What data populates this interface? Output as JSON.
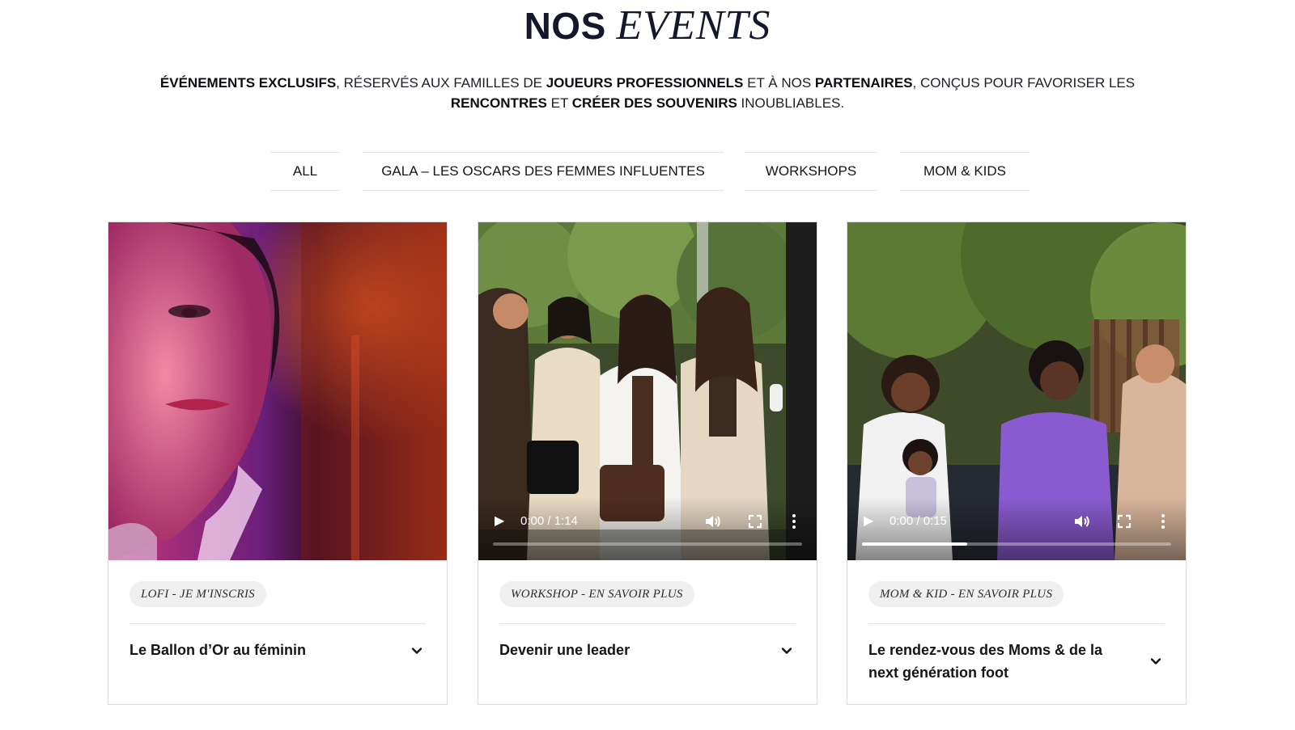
{
  "header": {
    "title_part1": "NOS",
    "title_part2": "EVENTS"
  },
  "intro": {
    "s1_bold": "ÉVÉNEMENTS EXCLUSIFS",
    "s2": ", RÉSERVÉS AUX FAMILLES DE ",
    "s3_bold": "JOUEURS PROFESSIONNELS",
    "s4": " ET À NOS ",
    "s5_bold": "PARTENAIRES",
    "s6": ", CONÇUS POUR FAVORISER LES ",
    "s7_bold": "RENCONTRES",
    "s8": " ET ",
    "s9_bold": "CRÉER DES SOUVENIRS",
    "s10": " INOUBLIABLES."
  },
  "tabs": [
    {
      "label": "ALL",
      "active": true
    },
    {
      "label": "GALA – LES OSCARS DES FEMMES INFLUENTES",
      "active": false
    },
    {
      "label": "WORKSHOPS",
      "active": false
    },
    {
      "label": "MOM & KIDS",
      "active": false
    }
  ],
  "cards": [
    {
      "tag": "LOFI - JE M'INSCRIS",
      "title": "Le Ballon d’Or au féminin",
      "media": "image",
      "icon": "chevron-down-icon"
    },
    {
      "tag": "WORKSHOP - EN SAVOIR PLUS",
      "title": "Devenir une leader",
      "media": "video",
      "video_time": "0:00 / 1:14",
      "video_progress": 0,
      "icon": "chevron-down-icon"
    },
    {
      "tag": "MOM & KID - EN SAVOIR PLUS",
      "title": "Le rendez-vous des Moms & de la next génération foot",
      "media": "video",
      "video_time": "0:00 / 0:15",
      "video_progress": 0.34,
      "icon": "chevron-down-icon"
    }
  ],
  "colors": {
    "title": "#15182a",
    "text": "#1c1f27",
    "tab_border": "#e6e6e6",
    "pill_bg": "#f0f0f1",
    "card_border": "#dcdcdc"
  }
}
